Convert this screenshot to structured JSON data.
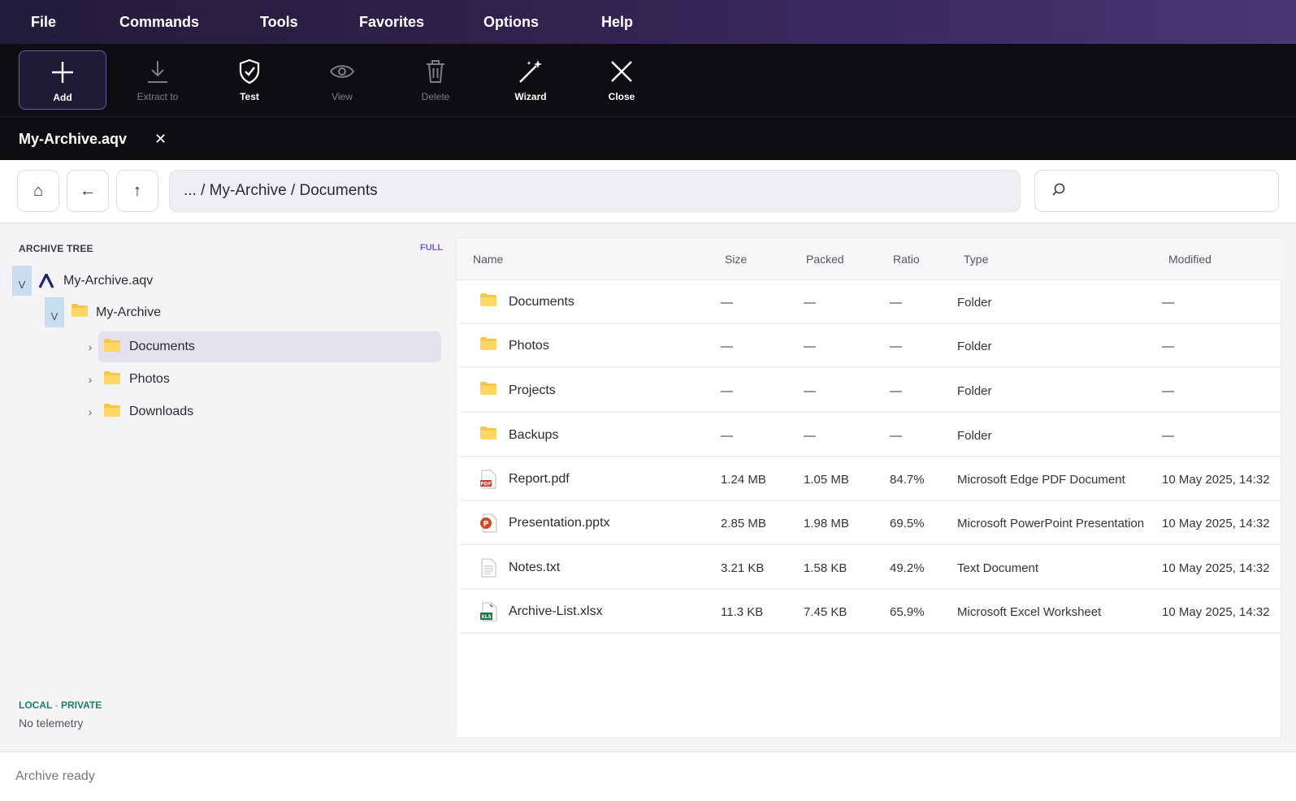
{
  "menu": [
    "File",
    "Commands",
    "Tools",
    "Favorites",
    "Options",
    "Help"
  ],
  "toolbar": [
    {
      "label": "Add",
      "icon": "plus-icon",
      "state": "active"
    },
    {
      "label": "Extract to",
      "icon": "download-icon",
      "state": "disabled"
    },
    {
      "label": "Test",
      "icon": "shield-check-icon",
      "state": "enabled"
    },
    {
      "label": "View",
      "icon": "eye-icon",
      "state": "disabled"
    },
    {
      "label": "Delete",
      "icon": "trash-icon",
      "state": "disabled"
    },
    {
      "label": "Wizard",
      "icon": "magic-wand-icon",
      "state": "enabled"
    },
    {
      "label": "Close",
      "icon": "close-x-icon",
      "state": "enabled"
    }
  ],
  "doc_tab": {
    "title": "My-Archive.aqv",
    "close": "✕"
  },
  "nav": {
    "home": "⌂",
    "back": "←",
    "up": "↑",
    "path": "... / My-Archive / Documents",
    "search_placeholder": ""
  },
  "sidebar": {
    "title": "ARCHIVE TREE",
    "mode": "FULL",
    "tree": [
      {
        "label": "My-Archive.aqv",
        "twisty": "V",
        "icon": "archive-logo-icon"
      },
      {
        "label": "My-Archive",
        "twisty": "V",
        "icon": "folder-icon"
      },
      {
        "label": "Documents",
        "twisty": "›",
        "icon": "folder-icon",
        "selected": true
      },
      {
        "label": "Photos",
        "twisty": "›",
        "icon": "folder-icon"
      },
      {
        "label": "Downloads",
        "twisty": "›",
        "icon": "folder-icon"
      }
    ],
    "privacy_local": "LOCAL",
    "privacy_sep": " - ",
    "privacy_private": "PRIVATE",
    "telemetry": "No telemetry"
  },
  "columns": [
    "Name",
    "Size",
    "Packed",
    "Ratio",
    "Type",
    "Modified"
  ],
  "files": [
    {
      "name": "Documents",
      "icon": "folder-icon",
      "size": "—",
      "packed": "—",
      "ratio": "—",
      "type": "Folder",
      "modified": "—"
    },
    {
      "name": "Photos",
      "icon": "folder-icon",
      "size": "—",
      "packed": "—",
      "ratio": "—",
      "type": "Folder",
      "modified": "—"
    },
    {
      "name": "Projects",
      "icon": "folder-icon",
      "size": "—",
      "packed": "—",
      "ratio": "—",
      "type": "Folder",
      "modified": "—"
    },
    {
      "name": "Backups",
      "icon": "folder-icon",
      "size": "—",
      "packed": "—",
      "ratio": "—",
      "type": "Folder",
      "modified": "—"
    },
    {
      "name": "Report.pdf",
      "icon": "pdf-file-icon",
      "size": "1.24 MB",
      "packed": "1.05 MB",
      "ratio": "84.7%",
      "type": "Microsoft Edge PDF Document",
      "modified": "10 May 2025, 14:32"
    },
    {
      "name": "Presentation.pptx",
      "icon": "powerpoint-file-icon",
      "size": "2.85 MB",
      "packed": "1.98 MB",
      "ratio": "69.5%",
      "type": "Microsoft PowerPoint Presentation",
      "modified": "10 May 2025, 14:32"
    },
    {
      "name": "Notes.txt",
      "icon": "text-file-icon",
      "size": "3.21 KB",
      "packed": "1.58 KB",
      "ratio": "49.2%",
      "type": "Text Document",
      "modified": "10 May 2025, 14:32"
    },
    {
      "name": "Archive-List.xlsx",
      "icon": "excel-file-icon",
      "size": "11.3 KB",
      "packed": "7.45 KB",
      "ratio": "65.9%",
      "type": "Microsoft Excel Worksheet",
      "modified": "10 May 2025, 14:32"
    }
  ],
  "status": "Archive ready"
}
